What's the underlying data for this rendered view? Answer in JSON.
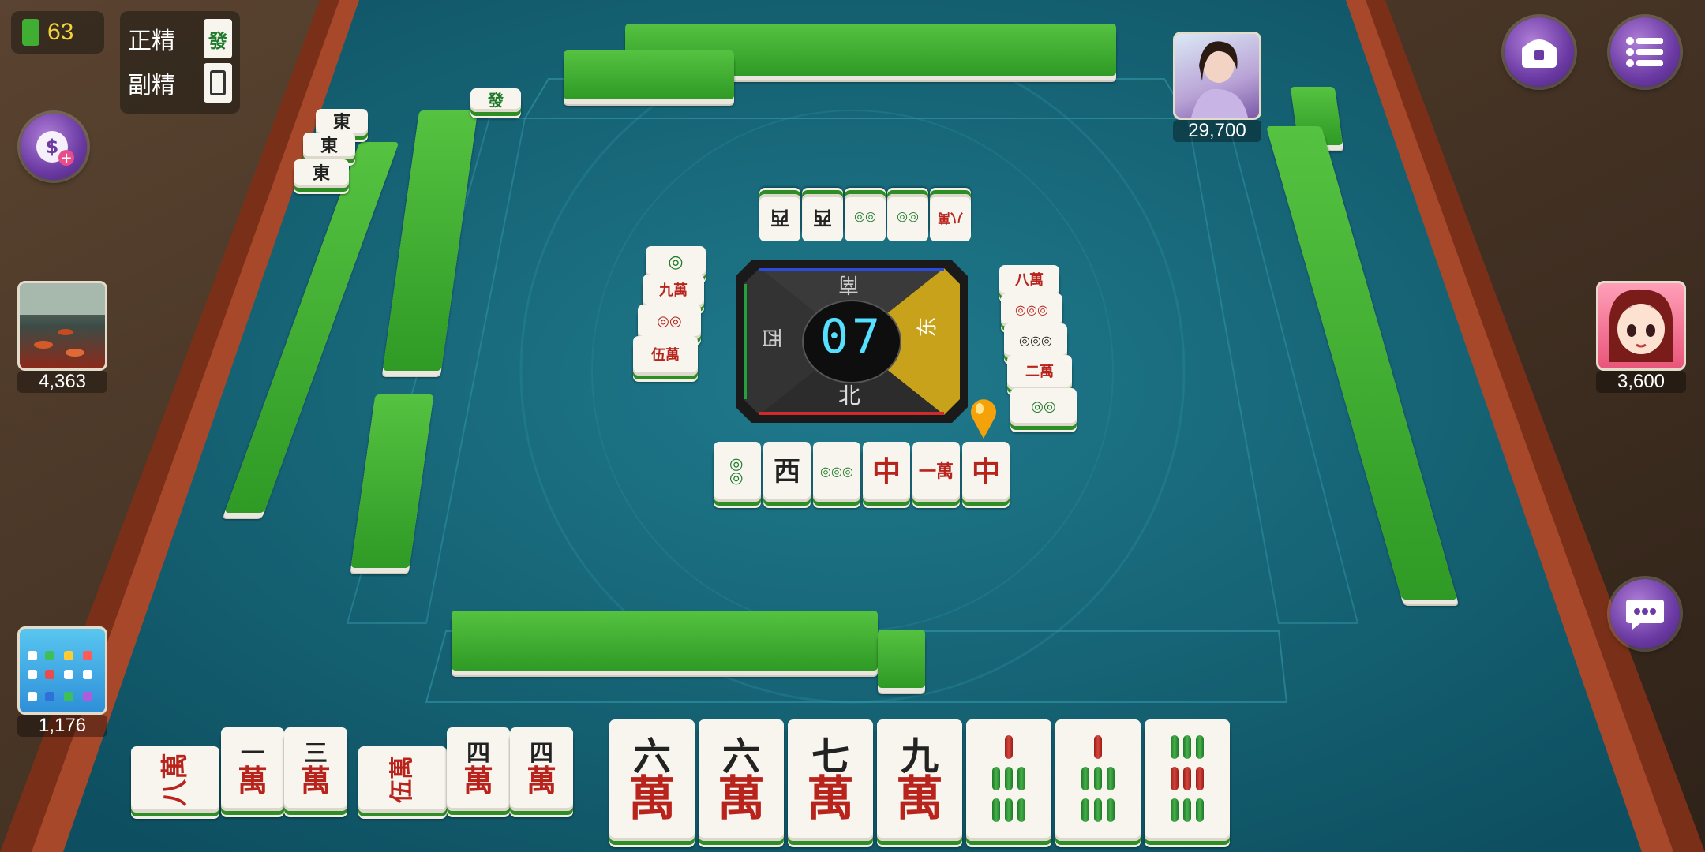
{
  "hud": {
    "wall_count": "63",
    "zheng_jing_label": "正精",
    "zheng_jing_tile": "發",
    "fu_jing_label": "副精"
  },
  "players": {
    "top_score": "29,700",
    "left_score": "4,363",
    "right_score": "3,600",
    "self_score": "1,176"
  },
  "compass": {
    "countdown": "07",
    "north": "北",
    "south": "南",
    "east": "东",
    "west": "西"
  },
  "discards": {
    "top": [
      "八萬",
      "◎◎",
      "◎◎",
      "西",
      "西"
    ],
    "left": [
      "◎",
      "九萬",
      "◎◎",
      "伍萬"
    ],
    "right": [
      "八萬",
      "◎◎◎",
      "◎◎◎",
      "二萬",
      "◎◎"
    ],
    "bottom": [
      "◎◎",
      "西",
      "◎◎◎",
      "中",
      "一萬",
      "中"
    ]
  },
  "left_melds": [
    "東",
    "東",
    "東"
  ],
  "top_left_meld": "發",
  "hand": {
    "melds": [
      {
        "top": "八",
        "bottom": "萬"
      },
      {
        "top": "一",
        "bottom": "萬"
      },
      {
        "top": "三",
        "bottom": "萬"
      },
      {
        "top": "伍",
        "bottom": "萬"
      },
      {
        "top": "四",
        "bottom": "萬"
      },
      {
        "top": "四",
        "bottom": "萬"
      }
    ],
    "tiles": [
      {
        "top": "六",
        "bottom": "萬"
      },
      {
        "top": "六",
        "bottom": "萬"
      },
      {
        "top": "七",
        "bottom": "萬"
      },
      {
        "top": "九",
        "bottom": "萬"
      }
    ],
    "bamboo_tiles": 3
  },
  "colors": {
    "felt": "#0f5a6e",
    "tile_back": "#3fae32",
    "wood": "#8a3b22"
  }
}
